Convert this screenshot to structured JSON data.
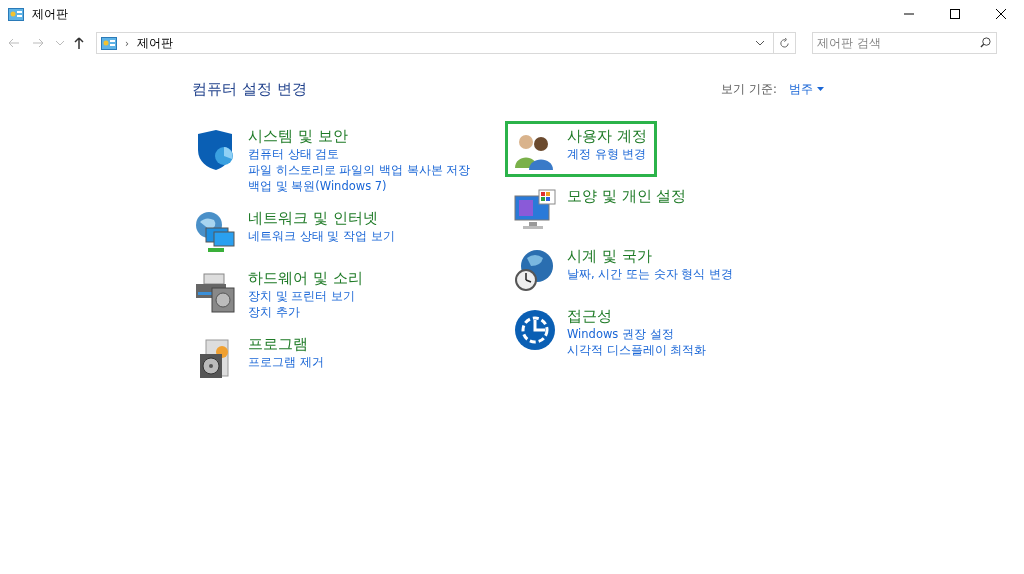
{
  "window": {
    "title": "제어판"
  },
  "address_bar": {
    "separator": "›",
    "path": "제어판"
  },
  "search": {
    "placeholder": "제어판 검색"
  },
  "heading": "컴퓨터 설정 변경",
  "view_by": {
    "label": "보기 기준:",
    "value": "범주"
  },
  "columns": [
    {
      "categories": [
        {
          "kind": "shield",
          "title": "시스템 및 보안",
          "highlighted": false,
          "links": [
            "컴퓨터 상태 검토",
            "파일 히스토리로 파일의 백업 복사본 저장",
            "백업 및 복원(Windows 7)"
          ]
        },
        {
          "kind": "network",
          "title": "네트워크 및 인터넷",
          "highlighted": false,
          "links": [
            "네트워크 상태 및 작업 보기"
          ]
        },
        {
          "kind": "hardware",
          "title": "하드웨어 및 소리",
          "highlighted": false,
          "links": [
            "장치 및 프린터 보기",
            "장치 추가"
          ]
        },
        {
          "kind": "programs",
          "title": "프로그램",
          "highlighted": false,
          "links": [
            "프로그램 제거"
          ]
        }
      ]
    },
    {
      "categories": [
        {
          "kind": "users",
          "title": "사용자 계정",
          "highlighted": true,
          "links": [
            "계정 유형 변경"
          ]
        },
        {
          "kind": "appearance",
          "title": "모양 및 개인 설정",
          "highlighted": false
        },
        {
          "kind": "clock",
          "title": "시계 및 국가",
          "highlighted": false,
          "links": [
            "날짜, 시간 또는 숫자 형식 변경"
          ]
        },
        {
          "kind": "accessibility",
          "title": "접근성",
          "highlighted": false,
          "links": [
            "Windows 권장 설정",
            "시각적 디스플레이 최적화"
          ]
        }
      ]
    }
  ]
}
